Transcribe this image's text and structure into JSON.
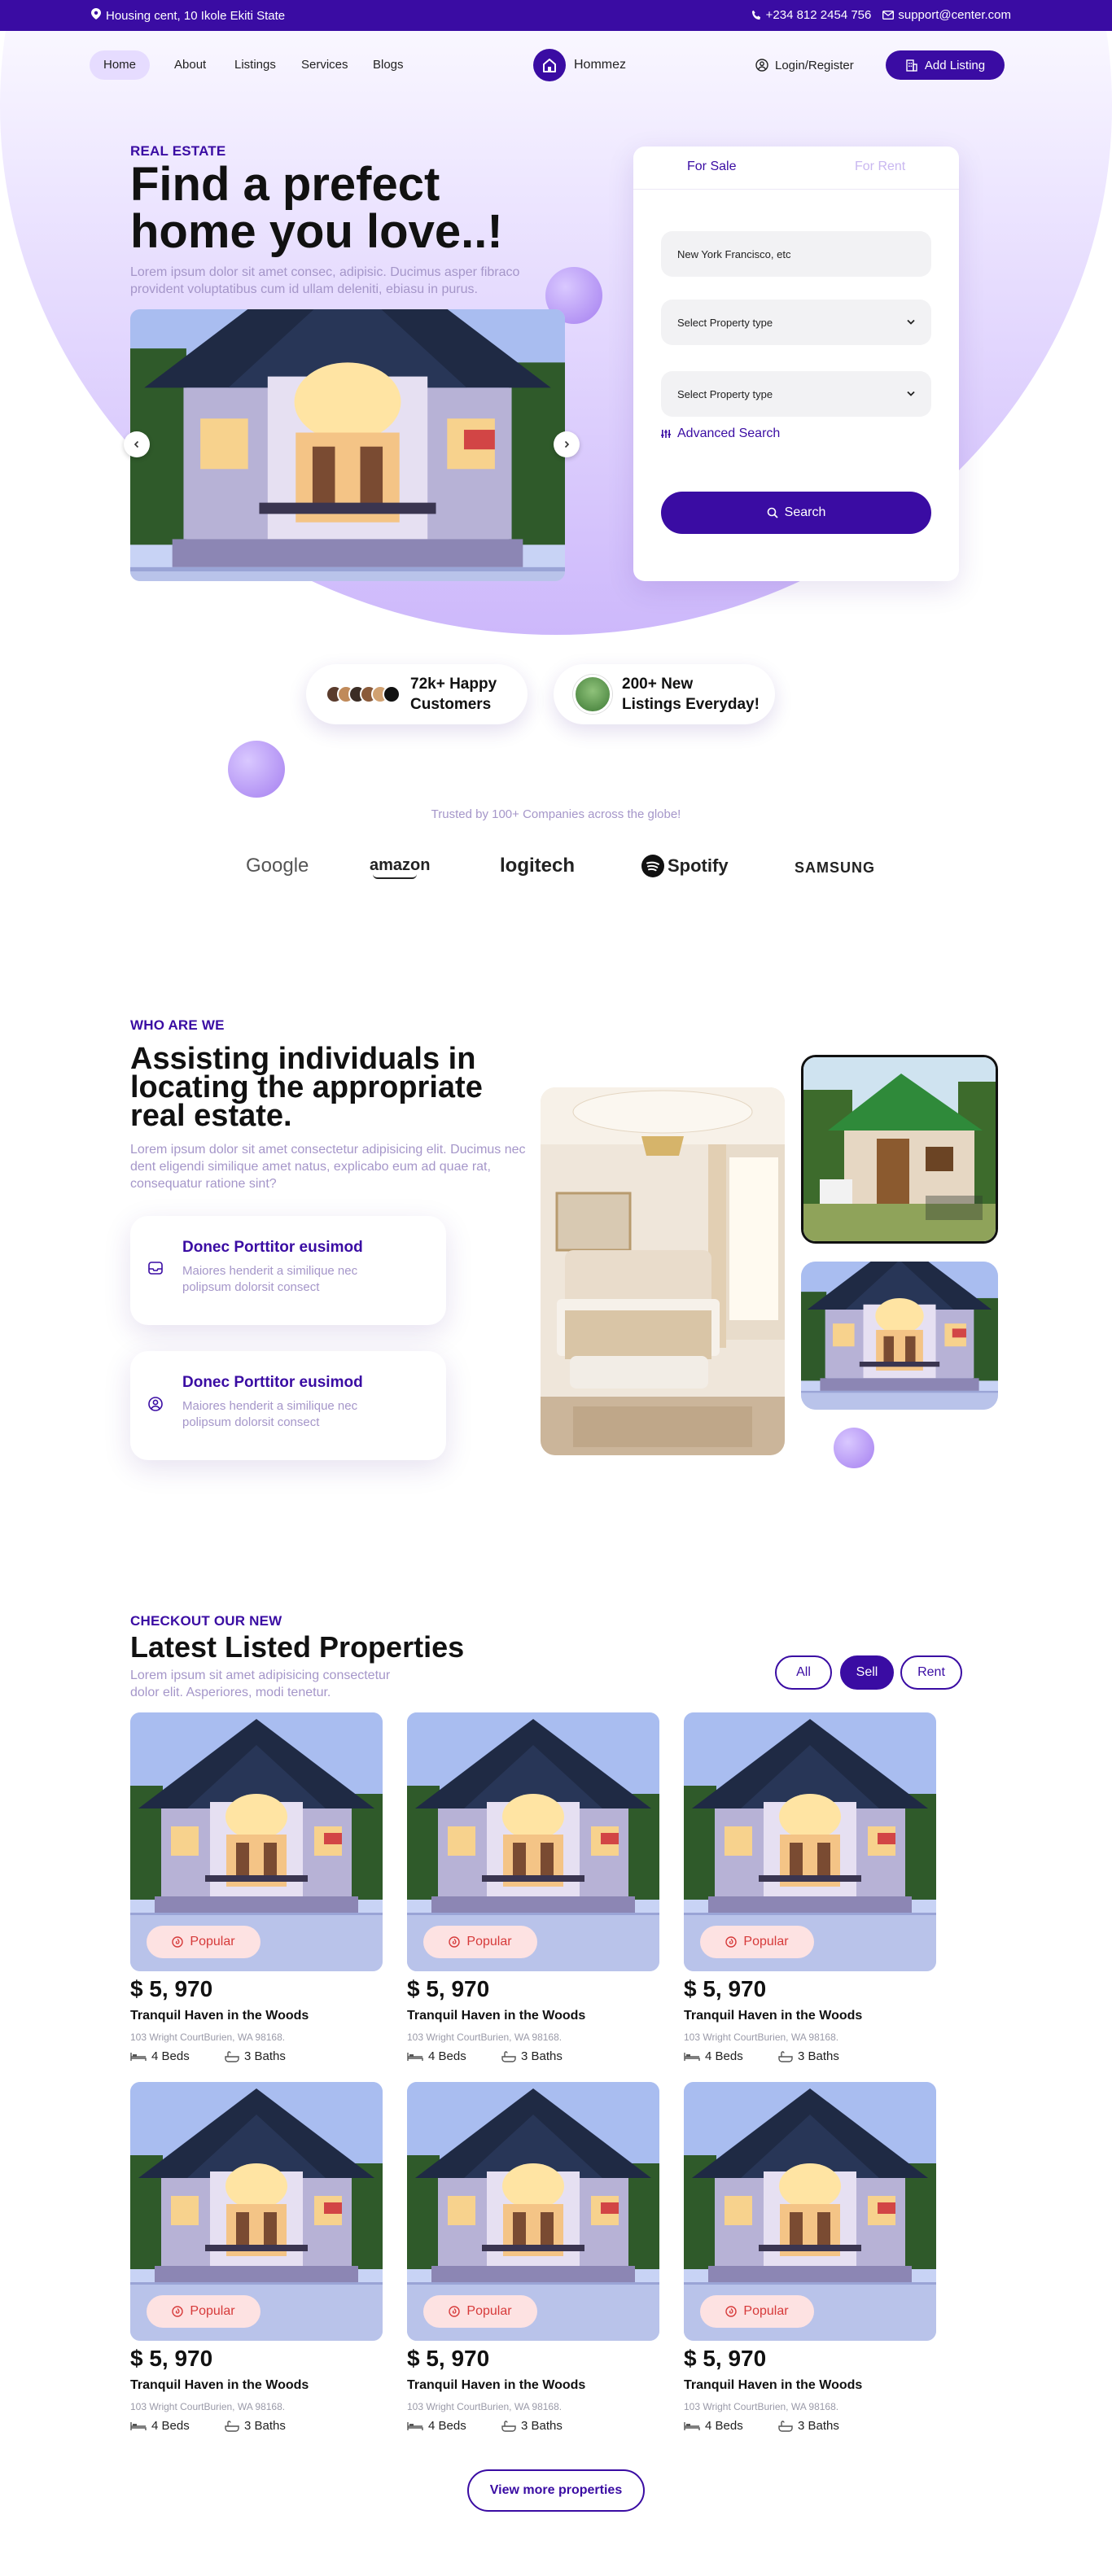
{
  "topbar": {
    "address": "Housing cent, 10 Ikole Ekiti State",
    "phone": "+234 812 2454 756",
    "email": "support@center.com"
  },
  "nav": {
    "home": "Home",
    "about": "About",
    "listings": "Listings",
    "services": "Services",
    "blogs": "Blogs",
    "brand": "Hommez",
    "login": "Login/Register",
    "add_listing": "Add Listing"
  },
  "hero": {
    "eyebrow": "REAL ESTATE",
    "title_line1": "Find a prefect",
    "title_line2": "home you love..!",
    "description": "Lorem ipsum dolor sit amet consec, adipisic. Ducimus asper fibraco provident voluptatibus cum id ullam deleniti, ebiasu in purus."
  },
  "search": {
    "tab_sale": "For Sale",
    "tab_rent": "For Rent",
    "location_value": "New York Francisco, etc",
    "type_select": "Select Property type",
    "type_select_2": "Select Property type",
    "advanced": "Advanced Search",
    "button": "Search"
  },
  "stats": {
    "customers_line1": "72k+ Happy",
    "customers_line2": "Customers",
    "listings_line1": "200+ New",
    "listings_line2": "Listings Everyday!"
  },
  "trusted": {
    "text": "Trusted by 100+ Companies across the globe!",
    "logos": {
      "google": "Google",
      "amazon": "amazon",
      "logitech": "logitech",
      "spotify": "Spotify",
      "samsung": "SAMSUNG"
    }
  },
  "about": {
    "eyebrow": "WHO ARE WE",
    "title_line1": "Assisting individuals in",
    "title_line2": "locating the appropriate",
    "title_line3": "real estate.",
    "description": "Lorem ipsum dolor sit amet consectetur adipisicing elit. Ducimus nec dent eligendi similique amet natus, explicabo eum ad quae rat, consequatur ratione sint?",
    "features": [
      {
        "title": "Donec Porttitor eusimod",
        "desc": "Maiores henderit a similique nec polipsum dolorsit consect"
      },
      {
        "title": "Donec Porttitor eusimod",
        "desc": "Maiores henderit a similique nec polipsum dolorsit consect"
      }
    ]
  },
  "listings": {
    "eyebrow": "CHECKOUT OUR NEW",
    "title": "Latest Listed Properties",
    "description": "Lorem ipsum sit amet adipisicing consectetur dolor elit. Asperiores, modi tenetur.",
    "filters": {
      "all": "All",
      "sell": "Sell",
      "rent": "Rent"
    },
    "items": [
      {
        "badge": "Popular",
        "price": "$ 5, 970",
        "name": "Tranquil Haven in the Woods",
        "address": "103 Wright CourtBurien, WA 98168.",
        "beds": "4 Beds",
        "baths": "3 Baths"
      },
      {
        "badge": "Popular",
        "price": "$ 5, 970",
        "name": "Tranquil Haven in the Woods",
        "address": "103 Wright CourtBurien, WA 98168.",
        "beds": "4 Beds",
        "baths": "3 Baths"
      },
      {
        "badge": "Popular",
        "price": "$ 5, 970",
        "name": "Tranquil Haven in the Woods",
        "address": "103 Wright CourtBurien, WA 98168.",
        "beds": "4 Beds",
        "baths": "3 Baths"
      },
      {
        "badge": "Popular",
        "price": "$ 5, 970",
        "name": "Tranquil Haven in the Woods",
        "address": "103 Wright CourtBurien, WA 98168.",
        "beds": "4 Beds",
        "baths": "3 Baths"
      },
      {
        "badge": "Popular",
        "price": "$ 5, 970",
        "name": "Tranquil Haven in the Woods",
        "address": "103 Wright CourtBurien, WA 98168.",
        "beds": "4 Beds",
        "baths": "3 Baths"
      },
      {
        "badge": "Popular",
        "price": "$ 5, 970",
        "name": "Tranquil Haven in the Woods",
        "address": "103 Wright CourtBurien, WA 98168.",
        "beds": "4 Beds",
        "baths": "3 Baths"
      }
    ],
    "more_button": "View more properties"
  },
  "colors": {
    "primary": "#3a0ca3",
    "muted_text": "#a596c9",
    "badge_bg": "#fde2e2",
    "badge_text": "#d63a3a"
  }
}
